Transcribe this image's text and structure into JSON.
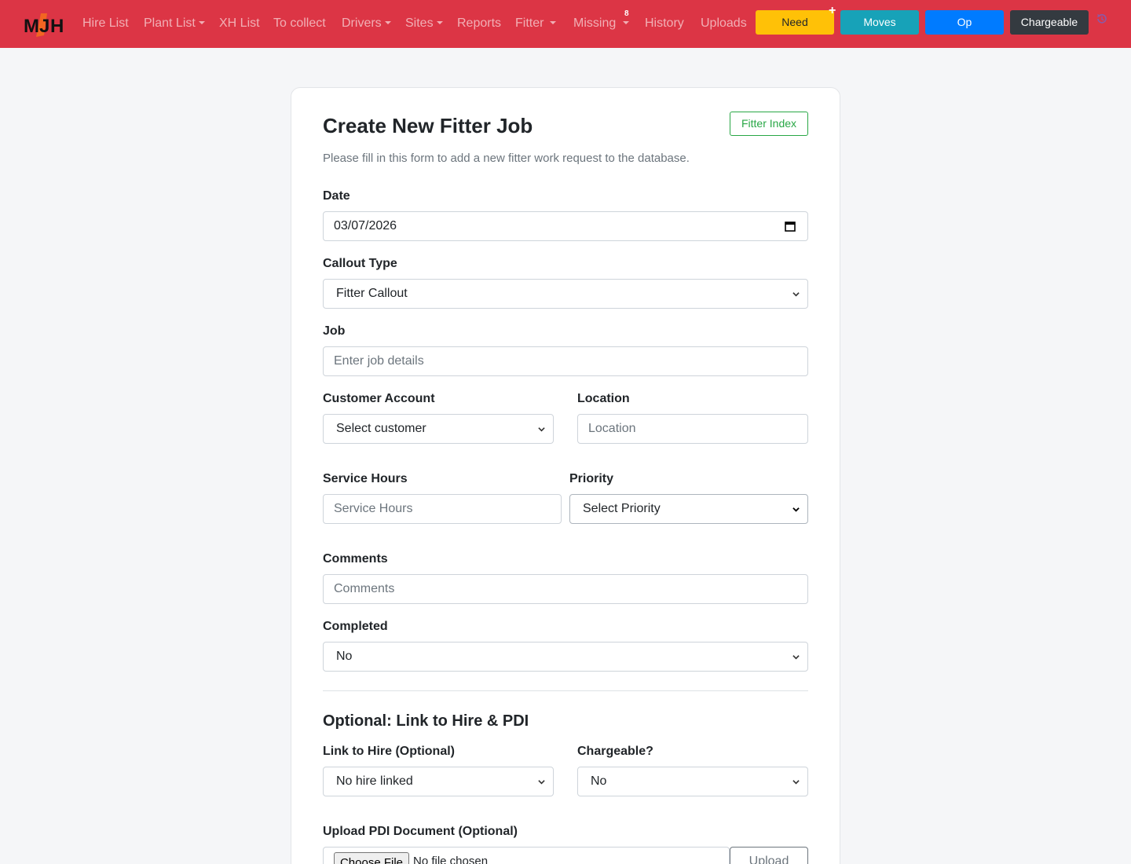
{
  "navbar": {
    "logo_text": "MJH",
    "links": {
      "hire_list": "Hire List",
      "plant_list": "Plant List",
      "xh_list": "XH List",
      "to_collect": "To collect",
      "drivers": "Drivers",
      "sites": "Sites",
      "reports": "Reports",
      "fitter": "Fitter",
      "missing": "Missing",
      "history": "History",
      "uploads": "Uploads"
    },
    "missing_count": "8",
    "buttons": {
      "need": "Need",
      "moves": "Moves",
      "op": "Op",
      "chargeable": "Chargeable"
    },
    "plus_icon": "+",
    "icons": [
      "plus-icon",
      "history-icon",
      "chevron-down-icon"
    ],
    "colors": {
      "navbar_bg": "#dc3545",
      "need": "#ffc107",
      "moves": "#17a2b8",
      "op": "#007bff",
      "chargeable": "#343a40"
    }
  },
  "form": {
    "title": "Create New Fitter Job",
    "fitter_index": "Fitter Index",
    "subtitle": "Please fill in this form to add a new fitter work request to the database.",
    "date": {
      "label": "Date",
      "value": "03/07/2026"
    },
    "callout_type": {
      "label": "Callout Type",
      "value": "Fitter Callout"
    },
    "job": {
      "label": "Job",
      "placeholder": "Enter job details"
    },
    "customer_account": {
      "label": "Customer Account",
      "value": "Select customer"
    },
    "location": {
      "label": "Location",
      "placeholder": "Location"
    },
    "service_hours": {
      "label": "Service Hours",
      "placeholder": "Service Hours"
    },
    "priority": {
      "label": "Priority",
      "value": "Select Priority"
    },
    "comments": {
      "label": "Comments",
      "placeholder": "Comments"
    },
    "completed": {
      "label": "Completed",
      "value": "No"
    },
    "optional_section": "Optional: Link to Hire & PDI",
    "link_to_hire": {
      "label": "Link to Hire (Optional)",
      "value": "No hire linked"
    },
    "chargeable": {
      "label": "Chargeable?",
      "value": "No"
    },
    "pdi_upload": {
      "label": "Upload PDI Document (Optional)",
      "choose_file": "Choose File",
      "no_file": "No file chosen",
      "upload": "Upload"
    }
  }
}
